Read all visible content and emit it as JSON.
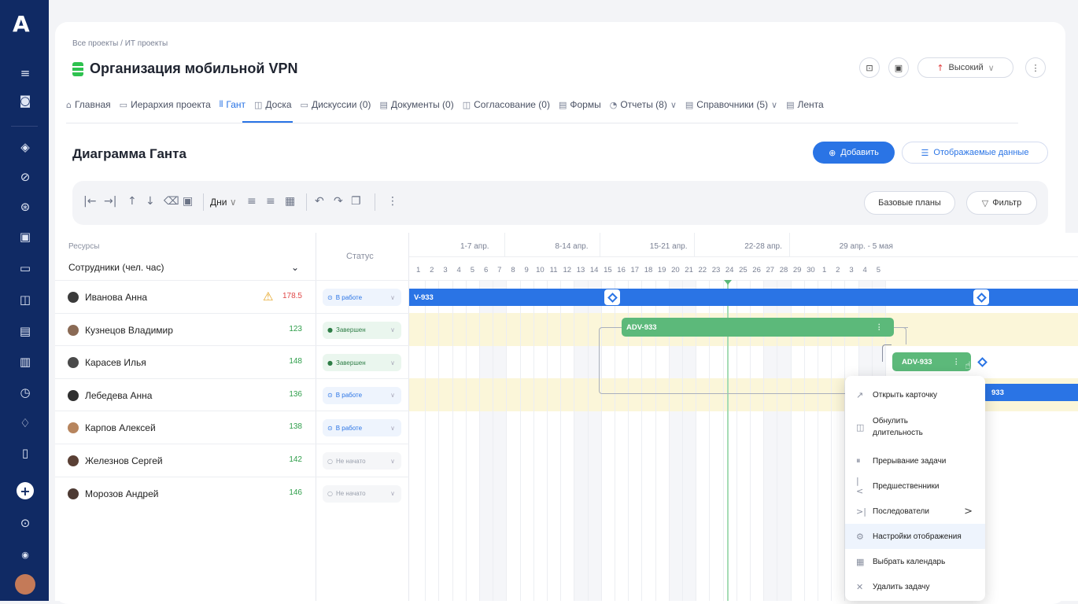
{
  "app": {
    "logo": "A"
  },
  "sidebar": {
    "icons": [
      "menu-icon",
      "search-doc-icon",
      "layers-icon",
      "check-circle-icon",
      "arrow-circle-icon",
      "calendar-icon",
      "chat-icon",
      "board-icon",
      "document-icon",
      "report-icon",
      "clock-icon",
      "bell-icon",
      "bookmark-icon",
      "plus-icon",
      "help-icon",
      "user-avatar-small",
      "user-avatar"
    ]
  },
  "header": {
    "breadcrumb": "Все проекты / ИТ проекты",
    "title": "Организация мобильной VPN",
    "priority": "Высокий"
  },
  "tabs": [
    {
      "label": "Главная",
      "icon": "⌂"
    },
    {
      "label": "Иерархия проекта",
      "icon": "▭"
    },
    {
      "label": "Гант",
      "icon": "⫴",
      "active": true
    },
    {
      "label": "Доска",
      "icon": "◫"
    },
    {
      "label": "Дискуссии (0)",
      "icon": "▭"
    },
    {
      "label": "Документы (0)",
      "icon": "▤"
    },
    {
      "label": "Согласование (0)",
      "icon": "◫"
    },
    {
      "label": "Формы",
      "icon": "▤"
    },
    {
      "label": "Отчеты (8)",
      "icon": "◔",
      "dropdown": "∨"
    },
    {
      "label": "Справочники (5)",
      "icon": "▤",
      "dropdown": "∨"
    },
    {
      "label": "Лента",
      "icon": "▤"
    }
  ],
  "section": {
    "title": "Диаграмма Ганта",
    "add_label": "Добавить",
    "display_label": "Отображаемые данные"
  },
  "toolbar": {
    "scale": "Дни",
    "baselines": "Базовые планы",
    "filter": "Фильтр"
  },
  "grid": {
    "resources_label": "Ресурсы",
    "employees_label": "Сотрудники (чел. час)",
    "status_label": "Статус",
    "rows": [
      {
        "name": "Иванова Анна",
        "hours": "178.5",
        "warn": true,
        "status": "В работе",
        "kind": "work",
        "av": "#3b3b3b"
      },
      {
        "name": "Кузнецов Владимир",
        "hours": "123",
        "status": "Завершен",
        "kind": "done",
        "av": "#8a6a55"
      },
      {
        "name": "Карасев Илья",
        "hours": "148",
        "status": "Завершен",
        "kind": "done",
        "av": "#4a4a4a"
      },
      {
        "name": "Лебедева Анна",
        "hours": "136",
        "status": "В работе",
        "kind": "work",
        "av": "#2f2f2f"
      },
      {
        "name": "Карпов Алексей",
        "hours": "138",
        "status": "В работе",
        "kind": "work",
        "av": "#b7855e"
      },
      {
        "name": "Железнов Сергей",
        "hours": "142",
        "status": "Не начато",
        "kind": "none",
        "av": "#5a4035"
      },
      {
        "name": "Морозов Андрей",
        "hours": "146",
        "status": "Не начато",
        "kind": "none",
        "av": "#4d3a33"
      }
    ]
  },
  "timeline": {
    "weeks": [
      "1-7 апр.",
      "8-14 апр.",
      "15-21 апр.",
      "22-28 апр.",
      "29 апр. - 5 мая"
    ],
    "days": [
      "1",
      "2",
      "3",
      "4",
      "5",
      "6",
      "7",
      "8",
      "9",
      "10",
      "11",
      "12",
      "13",
      "14",
      "15",
      "16",
      "17",
      "18",
      "19",
      "20",
      "21",
      "22",
      "23",
      "24",
      "25",
      "26",
      "27",
      "28",
      "29",
      "30",
      "1",
      "2",
      "3",
      "4",
      "5"
    ],
    "bars": [
      {
        "label": "V-933"
      },
      {
        "label": "ADV-933"
      },
      {
        "label": "ADV-933"
      },
      {
        "label": "933"
      }
    ]
  },
  "context_menu": [
    {
      "label": "Открыть карточку",
      "icon": "↗"
    },
    {
      "label": "Обнулить длительность",
      "icon": "◫"
    },
    {
      "label": "Прерывание задачи",
      "icon": "⏸"
    },
    {
      "label": "Предшественники",
      "icon": "|<"
    },
    {
      "label": "Последователи",
      "icon": ">|",
      "submenu": ">"
    },
    {
      "label": "Настройки отображения",
      "icon": "⚙",
      "highlight": true
    },
    {
      "label": "Выбрать календарь",
      "icon": "▦"
    },
    {
      "label": "Удалить задачу",
      "icon": "✕"
    }
  ],
  "colors": {
    "accent": "#2a74e5",
    "done": "#5cb97a",
    "warn": "#e5a31f",
    "sidebar": "#102a64"
  }
}
